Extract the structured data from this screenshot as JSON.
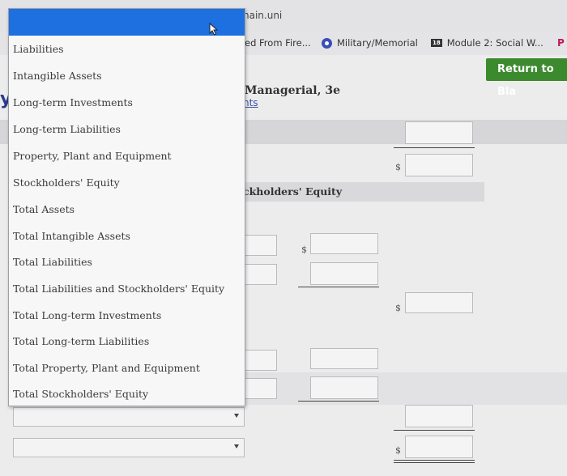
{
  "browser": {
    "url_fragment": "nain.uni",
    "bookmarks": [
      {
        "label": "ed From Fire...",
        "icon": "none"
      },
      {
        "label": "Military/Memorial",
        "icon": "globe-icon"
      },
      {
        "label": "Module 2: Social W...",
        "icon": "module-icon",
        "icon_text": "18"
      },
      {
        "label": "P",
        "icon": "pearson-icon"
      }
    ]
  },
  "page": {
    "return_button": "Return to Bla",
    "book_title": "Managerial, 3e",
    "points_link": "nts",
    "partial_heading_letter": "y",
    "section_title": "ckholders' Equity",
    "currency_symbol": "$"
  },
  "dropdown": {
    "selected": "",
    "options": [
      "Liabilities",
      "Intangible Assets",
      "Long-term Investments",
      "Long-term Liabilities",
      "Property, Plant and Equipment",
      "Stockholders' Equity",
      "Total Assets",
      "Total Intangible Assets",
      "Total Liabilities",
      "Total Liabilities and Stockholders' Equity",
      "Total Long-term Investments",
      "Total Long-term Liabilities",
      "Total Property, Plant and Equipment",
      "Total Stockholders' Equity"
    ]
  },
  "selects": [
    {
      "value": ""
    },
    {
      "value": ""
    }
  ],
  "inputs": {
    "row1_right": "",
    "row2_mid": "",
    "row3_left": "",
    "row3_mid": "",
    "row4_right": "",
    "row5_left": "",
    "row5_mid": "",
    "row6_left": "",
    "row6_mid": "",
    "row7_right": "",
    "row8_right": "",
    "top_right": ""
  }
}
